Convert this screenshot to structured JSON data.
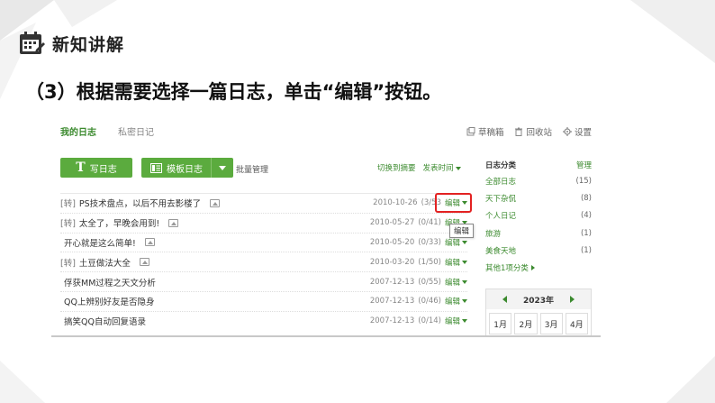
{
  "slide": {
    "header": "新知讲解",
    "instruction": "（3）根据需要选择一篇日志，单击“编辑”按钮。"
  },
  "blog": {
    "tabs": [
      {
        "label": "我的日志",
        "active": true
      },
      {
        "label": "私密日记",
        "active": false
      }
    ],
    "top_actions": [
      {
        "label": "草稿箱",
        "icon": "draft-icon"
      },
      {
        "label": "回收站",
        "icon": "trash-icon"
      },
      {
        "label": "设置",
        "icon": "gear-icon"
      }
    ],
    "buttons": {
      "write_label": "写日志",
      "template_label": "模板日志",
      "batch_label": "批量管理"
    },
    "sort": {
      "switch_label": "切换到摘要",
      "time_label": "发表时间"
    },
    "posts": [
      {
        "tag": "[转]",
        "title": "PS技术盘点，以后不用去影楼了",
        "date": "2010-10-26",
        "count": "(3/53",
        "edit": "编辑"
      },
      {
        "tag": "[转]",
        "title": "太全了，早晚会用到!",
        "date": "2010-05-27",
        "count": "(0/41)",
        "edit": "编辑"
      },
      {
        "tag": "",
        "title": "开心就是这么简单!",
        "date": "2010-05-20",
        "count": "(0/33)",
        "edit": "编辑"
      },
      {
        "tag": "[转]",
        "title": "土豆做法大全",
        "date": "2010-03-20",
        "count": "(1/50)",
        "edit": "编辑"
      },
      {
        "tag": "",
        "title": "俘获MM过程之天文分析",
        "date": "2007-12-13",
        "count": "(0/55)",
        "edit": "编辑"
      },
      {
        "tag": "",
        "title": "QQ上辨别好友是否隐身",
        "date": "2007-12-13",
        "count": "(0/46)",
        "edit": "编辑"
      },
      {
        "tag": "",
        "title": "搞笑QQ自动回复语录",
        "date": "2007-12-13",
        "count": "(0/14)",
        "edit": "编辑"
      }
    ],
    "tooltip": "编辑",
    "sidebar": {
      "title": "日志分类",
      "manage_label": "管理",
      "categories": [
        {
          "name": "全部日志",
          "count": "(15)"
        },
        {
          "name": "天下杂侃",
          "count": "(8)"
        },
        {
          "name": "个人日记",
          "count": "(4)"
        },
        {
          "name": "旅游",
          "count": "(1)"
        },
        {
          "name": "美食天地",
          "count": "(1)"
        }
      ],
      "more_label": "其他1项分类"
    },
    "calendar": {
      "year": "2023年",
      "months": [
        "1月",
        "2月",
        "3月",
        "4月"
      ]
    }
  },
  "colors": {
    "accent_green": "#3b8a2e",
    "button_green": "#5bab3e",
    "highlight_red": "#e32222"
  }
}
